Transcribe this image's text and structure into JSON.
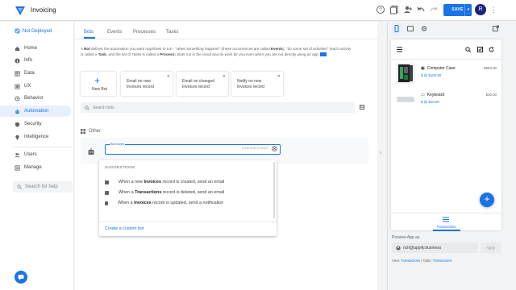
{
  "app": {
    "title": "Invoicing"
  },
  "toolbar": {
    "save_label": "SAVE",
    "avatar_letter": "R"
  },
  "sidebar": {
    "deploy_status": "Not Deployed",
    "items": [
      {
        "label": "Home"
      },
      {
        "label": "Info"
      },
      {
        "label": "Data"
      },
      {
        "label": "UX"
      },
      {
        "label": "Behavior"
      },
      {
        "label": "Automation"
      },
      {
        "label": "Security"
      },
      {
        "label": "Intelligence"
      },
      {
        "label": "Users"
      },
      {
        "label": "Manage"
      }
    ],
    "help_placeholder": "Search for help"
  },
  "main": {
    "tabs": [
      {
        "label": "Bots"
      },
      {
        "label": "Events"
      },
      {
        "label": "Processes"
      },
      {
        "label": "Tasks"
      }
    ],
    "description": {
      "t1": "A ",
      "b1": "Bot",
      "t2": " defines the automation you want AppSheet to run - \"when something happens\" (these occurrences are called ",
      "b2": "Events",
      "t3": "), \"do some set of activities\" (each activity is called a ",
      "b3": "Task",
      "t4": ", and the set of Tasks is called a ",
      "b4": "Process",
      "t5": "). Bots run in the cloud and do work for you even when you are not directly using an app."
    },
    "new_bot_label": "New Bot",
    "templates": [
      {
        "line1": "Email on new",
        "line2": "Invoices record"
      },
      {
        "line1": "Email on changed",
        "line2": "Invoices record"
      },
      {
        "line1": "Notify on new",
        "line2": "Invoices record"
      }
    ],
    "search_placeholder": "Search bots",
    "other_label": "Other",
    "bot_name_label": "Bot name",
    "enter_hint": "Press enter to insert",
    "suggestions": {
      "title": "SUGGESTIONS",
      "items": [
        {
          "pre": "When a new ",
          "bold": "Invoices",
          "post": " record is created, send an email"
        },
        {
          "pre": "When a ",
          "bold": "Transactions",
          "post": " record is deleted, send an email"
        },
        {
          "pre": "When a ",
          "bold": "Invoices",
          "post": " record is updated, send a notification"
        }
      ],
      "create_label": "Create a custom bot"
    }
  },
  "preview": {
    "rows": [
      {
        "name": "Computer Case",
        "price": "$ @ $100.00",
        "amount": "$500.00"
      },
      {
        "name": "Keyboard",
        "price": "$ @ $10.00",
        "amount": "$30.00"
      }
    ],
    "fab": "+",
    "nav_label": "Transactions",
    "preview_as_label": "Preview App as",
    "preview_as_value": "rich@appify.business",
    "apply_label": "Apply",
    "view_prefix": "View: ",
    "view_link": "Transactions",
    "table_prefix": " | Table: ",
    "table_link": "Transactions"
  }
}
